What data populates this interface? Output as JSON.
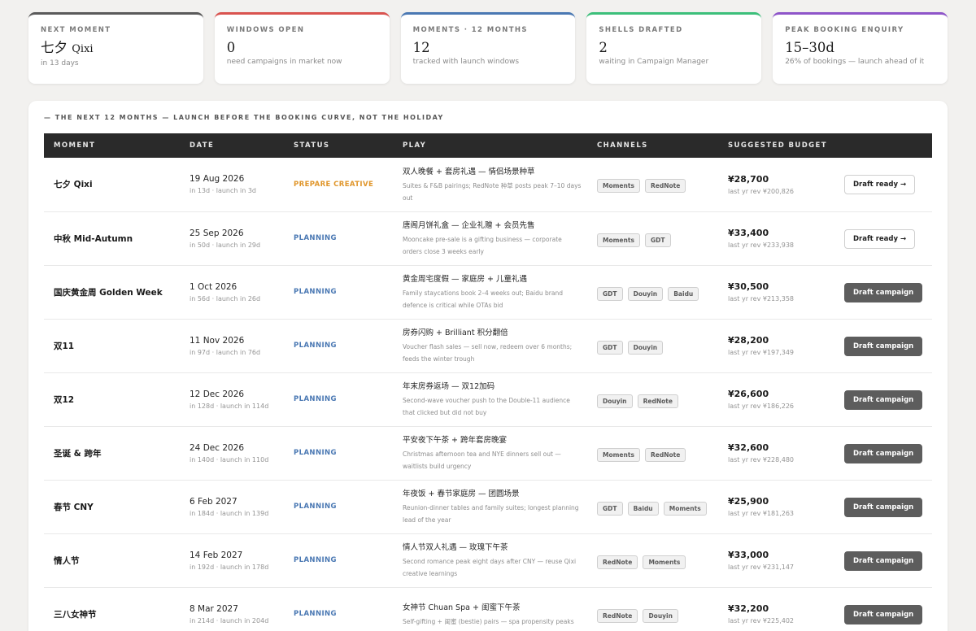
{
  "kpis": [
    {
      "label": "Next Moment",
      "value": "七夕",
      "value_sub": "Qixi",
      "sub": "in 13 days",
      "color": "#5a5a5a"
    },
    {
      "label": "Windows Open",
      "value": "0",
      "sub": "need campaigns in market now",
      "color": "#d9534f"
    },
    {
      "label": "Moments · 12 Months",
      "value": "12",
      "sub": "tracked with launch windows",
      "color": "#4a78b3"
    },
    {
      "label": "Shells Drafted",
      "value": "2",
      "sub": "waiting in Campaign Manager",
      "color": "#3cbf7a"
    },
    {
      "label": "Peak Booking Enquiry",
      "value": "15–30d",
      "sub": "26% of bookings — launch ahead of it",
      "color": "#8e55c9"
    }
  ],
  "section_heading": "— The next 12 months — launch before the booking curve, not the holiday",
  "table": {
    "headers": [
      "Moment",
      "Date",
      "Status",
      "Play",
      "Channels",
      "Suggested Budget",
      ""
    ],
    "rows": [
      {
        "moment": "七夕 Qixi",
        "date": "19 Aug 2026",
        "meta": "in 13d · launch in 3d",
        "status": "PREPARE CREATIVE",
        "status_kind": "prepare",
        "play_title": "双人晚餐 + 套房礼遇 — 情侣场景种草",
        "play_desc": "Suites & F&B pairings; RedNote 种草 posts peak 7–10 days out",
        "channels": [
          "Moments",
          "RedNote"
        ],
        "budget": "¥28,700",
        "last_year": "last yr rev ¥200,826",
        "action": "Draft ready →",
        "action_kind": "ready"
      },
      {
        "moment": "中秋 Mid-Autumn",
        "date": "25 Sep 2026",
        "meta": "in 50d · launch in 29d",
        "status": "PLANNING",
        "status_kind": "planning",
        "play_title": "唐阁月饼礼盒 — 企业礼赠 + 会员先售",
        "play_desc": "Mooncake pre-sale is a gifting business — corporate orders close 3 weeks early",
        "channels": [
          "Moments",
          "GDT"
        ],
        "budget": "¥33,400",
        "last_year": "last yr rev ¥233,938",
        "action": "Draft ready →",
        "action_kind": "ready"
      },
      {
        "moment": "国庆黄金周 Golden Week",
        "date": "1 Oct 2026",
        "meta": "in 56d · launch in 26d",
        "status": "PLANNING",
        "status_kind": "planning",
        "play_title": "黄金周宅度假 — 家庭房 + 儿童礼遇",
        "play_desc": "Family staycations book 2–4 weeks out; Baidu brand defence is critical while OTAs bid",
        "channels": [
          "GDT",
          "Douyin",
          "Baidu"
        ],
        "budget": "¥30,500",
        "last_year": "last yr rev ¥213,358",
        "action": "Draft campaign",
        "action_kind": "draft"
      },
      {
        "moment": "双11",
        "date": "11 Nov 2026",
        "meta": "in 97d · launch in 76d",
        "status": "PLANNING",
        "status_kind": "planning",
        "play_title": "房券闪购 + Brilliant 积分翻倍",
        "play_desc": "Voucher flash sales — sell now, redeem over 6 months; feeds the winter trough",
        "channels": [
          "GDT",
          "Douyin"
        ],
        "budget": "¥28,200",
        "last_year": "last yr rev ¥197,349",
        "action": "Draft campaign",
        "action_kind": "draft"
      },
      {
        "moment": "双12",
        "date": "12 Dec 2026",
        "meta": "in 128d · launch in 114d",
        "status": "PLANNING",
        "status_kind": "planning",
        "play_title": "年末房券返场 — 双12加码",
        "play_desc": "Second-wave voucher push to the Double-11 audience that clicked but did not buy",
        "channels": [
          "Douyin",
          "RedNote"
        ],
        "budget": "¥26,600",
        "last_year": "last yr rev ¥186,226",
        "action": "Draft campaign",
        "action_kind": "draft"
      },
      {
        "moment": "圣诞 & 跨年",
        "date": "24 Dec 2026",
        "meta": "in 140d · launch in 110d",
        "status": "PLANNING",
        "status_kind": "planning",
        "play_title": "平安夜下午茶 + 跨年套房晚宴",
        "play_desc": "Christmas afternoon tea and NYE dinners sell out — waitlists build urgency",
        "channels": [
          "Moments",
          "RedNote"
        ],
        "budget": "¥32,600",
        "last_year": "last yr rev ¥228,480",
        "action": "Draft campaign",
        "action_kind": "draft"
      },
      {
        "moment": "春节 CNY",
        "date": "6 Feb 2027",
        "meta": "in 184d · launch in 139d",
        "status": "PLANNING",
        "status_kind": "planning",
        "play_title": "年夜饭 + 春节家庭房 — 团圆场景",
        "play_desc": "Reunion-dinner tables and family suites; longest planning lead of the year",
        "channels": [
          "GDT",
          "Baidu",
          "Moments"
        ],
        "budget": "¥25,900",
        "last_year": "last yr rev ¥181,263",
        "action": "Draft campaign",
        "action_kind": "draft"
      },
      {
        "moment": "情人节",
        "date": "14 Feb 2027",
        "meta": "in 192d · launch in 178d",
        "status": "PLANNING",
        "status_kind": "planning",
        "play_title": "情人节双人礼遇 — 玫瑰下午茶",
        "play_desc": "Second romance peak eight days after CNY — reuse Qixi creative learnings",
        "channels": [
          "RedNote",
          "Moments"
        ],
        "budget": "¥33,000",
        "last_year": "last yr rev ¥231,147",
        "action": "Draft campaign",
        "action_kind": "draft"
      },
      {
        "moment": "三八女神节",
        "date": "8 Mar 2027",
        "meta": "in 214d · launch in 204d",
        "status": "PLANNING",
        "status_kind": "planning",
        "play_title": "女神节 Chuan Spa + 闺蜜下午茶",
        "play_desc": "Self-gifting + 闺蜜 (bestie) pairs — spa propensity peaks",
        "channels": [
          "RedNote",
          "Douyin"
        ],
        "budget": "¥32,200",
        "last_year": "last yr rev ¥225,402",
        "action": "Draft campaign",
        "action_kind": "draft"
      }
    ]
  }
}
